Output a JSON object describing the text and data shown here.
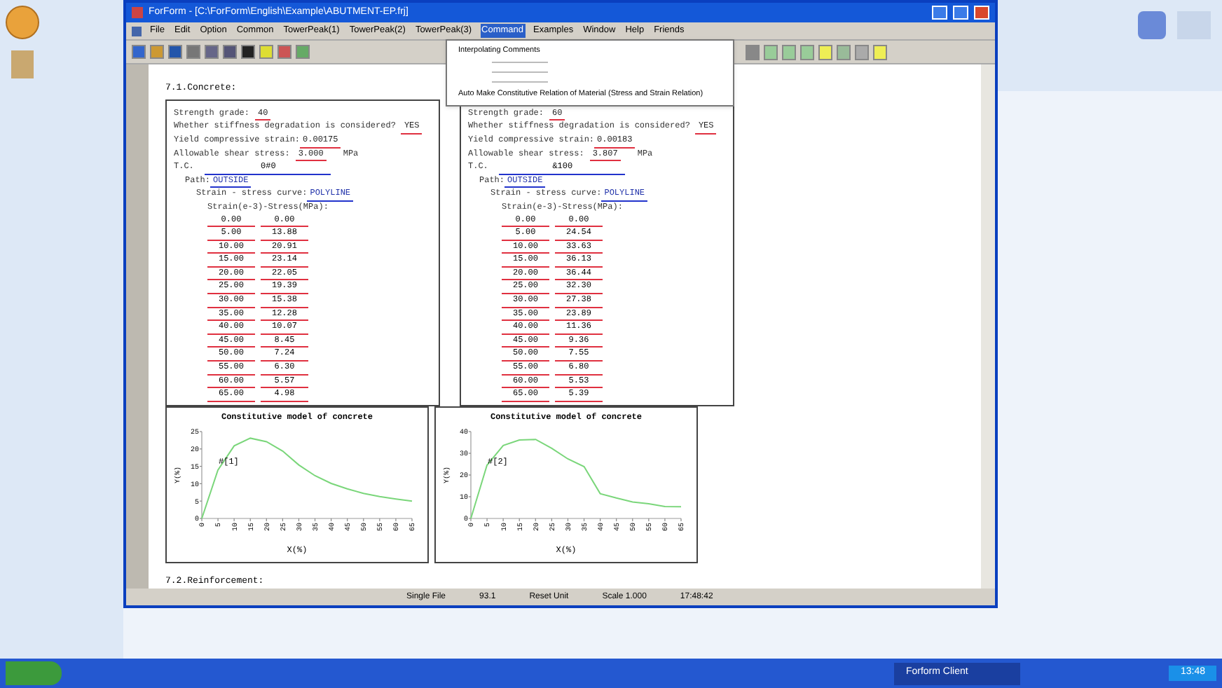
{
  "window": {
    "title": "ForForm - [C:\\ForForm\\English\\Example\\ABUTMENT-EP.frj]",
    "menu": [
      {
        "label": "File",
        "selected": false
      },
      {
        "label": "Edit",
        "selected": false
      },
      {
        "label": "Option",
        "selected": false
      },
      {
        "label": "Common",
        "selected": false
      },
      {
        "label": "TowerPeak(1)",
        "selected": false
      },
      {
        "label": "TowerPeak(2)",
        "selected": false
      },
      {
        "label": "TowerPeak(3)",
        "selected": false
      },
      {
        "label": "Command",
        "selected": true
      },
      {
        "label": "Examples",
        "selected": false
      },
      {
        "label": "Window",
        "selected": false
      },
      {
        "label": "Help",
        "selected": false
      },
      {
        "label": "Friends",
        "selected": false
      }
    ],
    "command_menu": [
      {
        "kind": "item",
        "label": "Interpolating Comments"
      },
      {
        "kind": "separator"
      },
      {
        "kind": "separator"
      },
      {
        "kind": "separator"
      },
      {
        "kind": "item",
        "label": "Auto Make Constitutive Relation of Material (Stress and Strain Relation)"
      }
    ]
  },
  "document": {
    "heading": "7.1.Concrete:",
    "panels": [
      {
        "strength_label": "Strength grade:",
        "strength": "40",
        "stiffness_label": "Whether stiffness degradation is considered?",
        "stiffness": "YES",
        "strain_label": "Yield compressive strain:",
        "strain": "0.00175",
        "shear_label": "Allowable shear stress:",
        "shear": "3.000",
        "shear_unit": "MPa",
        "tc_label": "T.C.",
        "tc": "0#0",
        "path_label": "Path:",
        "path": "OUTSIDE",
        "curve_label": "Strain - stress curve:",
        "curve": "POLYLINE",
        "table_label": "Strain(e-3)-Stress(MPa):",
        "pairs": [
          [
            "0.00",
            "0.00"
          ],
          [
            "5.00",
            "13.88"
          ],
          [
            "10.00",
            "20.91"
          ],
          [
            "15.00",
            "23.14"
          ],
          [
            "20.00",
            "22.05"
          ],
          [
            "25.00",
            "19.39"
          ],
          [
            "30.00",
            "15.38"
          ],
          [
            "35.00",
            "12.28"
          ],
          [
            "40.00",
            "10.07"
          ],
          [
            "45.00",
            "8.45"
          ],
          [
            "50.00",
            "7.24"
          ],
          [
            "55.00",
            "6.30"
          ],
          [
            "60.00",
            "5.57"
          ],
          [
            "65.00",
            "4.98"
          ]
        ]
      },
      {
        "strength_label": "Strength grade:",
        "strength": "60",
        "stiffness_label": "Whether stiffness degradation is considered?",
        "stiffness": "YES",
        "strain_label": "Yield compressive strain:",
        "strain": "0.00183",
        "shear_label": "Allowable shear stress:",
        "shear": "3.807",
        "shear_unit": "MPa",
        "tc_label": "T.C.",
        "tc": "&100",
        "path_label": "Path:",
        "path": "OUTSIDE",
        "curve_label": "Strain - stress curve:",
        "curve": "POLYLINE",
        "table_label": "Strain(e-3)-Stress(MPa):",
        "pairs": [
          [
            "0.00",
            "0.00"
          ],
          [
            "5.00",
            "24.54"
          ],
          [
            "10.00",
            "33.63"
          ],
          [
            "15.00",
            "36.13"
          ],
          [
            "20.00",
            "36.44"
          ],
          [
            "25.00",
            "32.30"
          ],
          [
            "30.00",
            "27.38"
          ],
          [
            "35.00",
            "23.89"
          ],
          [
            "40.00",
            "11.36"
          ],
          [
            "45.00",
            "9.36"
          ],
          [
            "50.00",
            "7.55"
          ],
          [
            "55.00",
            "6.80"
          ],
          [
            "60.00",
            "5.53"
          ],
          [
            "65.00",
            "5.39"
          ]
        ]
      }
    ],
    "charts": [
      {
        "chart_data": {
          "type": "line",
          "title": "Constitutive model of concrete",
          "xlabel": "X(%)",
          "ylabel": "Y(%)",
          "ylim": [
            0,
            25
          ],
          "yticks": [
            0,
            5,
            10,
            15,
            20,
            25
          ],
          "x": [
            0,
            5,
            10,
            15,
            20,
            25,
            30,
            35,
            40,
            45,
            50,
            55,
            60,
            65
          ],
          "series": [
            {
              "name": "#[1]",
              "color": "#7ad67a",
              "values": [
                0,
                13.9,
                20.9,
                23.1,
                22.1,
                19.4,
                15.4,
                12.3,
                10.1,
                8.5,
                7.2,
                6.3,
                5.6,
                5.0
              ]
            }
          ]
        }
      },
      {
        "chart_data": {
          "type": "line",
          "title": "Constitutive model of concrete",
          "xlabel": "X(%)",
          "ylabel": "Y(%)",
          "ylim": [
            0,
            40
          ],
          "yticks": [
            0,
            10,
            20,
            30,
            40
          ],
          "x": [
            0,
            5,
            10,
            15,
            20,
            25,
            30,
            35,
            40,
            45,
            50,
            55,
            60,
            65
          ],
          "series": [
            {
              "name": "#[2]",
              "color": "#7ad67a",
              "values": [
                0,
                24.5,
                33.6,
                36.1,
                36.4,
                32.3,
                27.4,
                23.9,
                11.4,
                9.4,
                7.6,
                6.8,
                5.5,
                5.4
              ]
            }
          ]
        }
      }
    ],
    "next_heading": "7.2.Reinforcement:"
  },
  "status_bar": [
    "Single File",
    "93.1",
    "Reset Unit",
    "Scale 1.000",
    "17:48:42"
  ],
  "taskbar": {
    "tasks": [
      {
        "label": "Forform Client",
        "selected": true
      }
    ],
    "clock": "13:48"
  }
}
